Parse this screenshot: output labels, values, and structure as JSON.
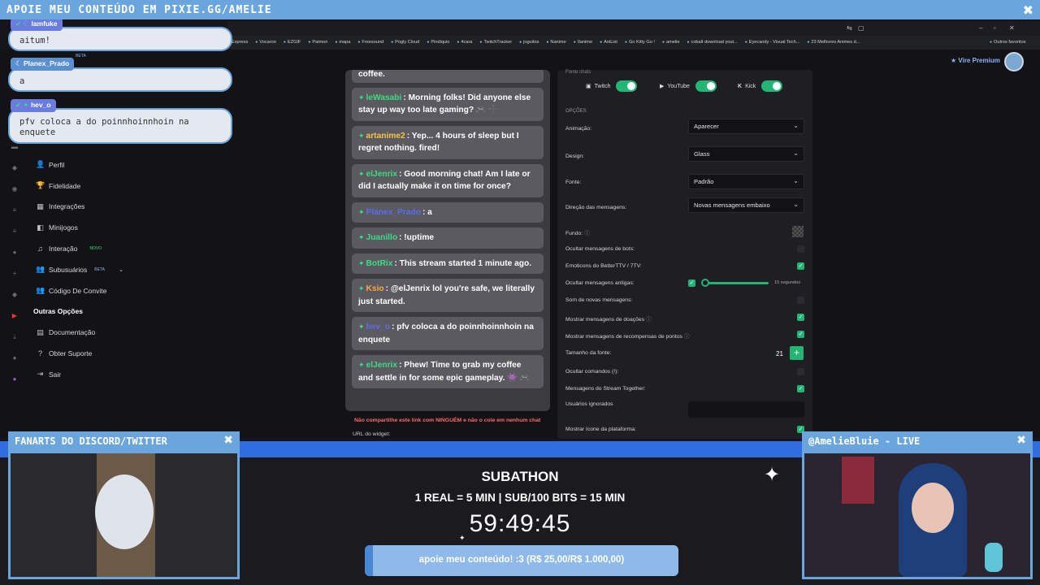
{
  "banner": {
    "text": "APOIE MEU CONTEÚDO EM PIXIE.GG/AMELIE",
    "close": "✖"
  },
  "bookmarks": [
    "Express",
    "Vocaroo",
    "EZGIF",
    "Paimon",
    "mapa",
    "Freesound",
    "Pogly Cloud",
    "Pindiquio",
    "4cara",
    "TwitchTracker",
    "joguitos",
    "Nanime",
    "9anime",
    "AniList",
    "Go Kitty Go !",
    "amelie",
    "cobalt download yout...",
    "Eyecandy - Visual Tech...",
    "23 Melhores Animes d...",
    "Outros favoritos"
  ],
  "header": {
    "premium": "Vire Premium",
    "beta": "BETA"
  },
  "nav": {
    "items": [
      {
        "label": "Perfil",
        "icon": "user-icon"
      },
      {
        "label": "Fidelidade",
        "icon": "trophy-icon"
      },
      {
        "label": "Integrações",
        "icon": "plug-icon"
      },
      {
        "label": "Minijogos",
        "icon": "gamepad-icon"
      },
      {
        "label": "Interação",
        "icon": "music-icon",
        "tag": "NOVO"
      },
      {
        "label": "Subusuários",
        "icon": "users-icon",
        "tag": "BETA"
      },
      {
        "label": "Código De Convite",
        "icon": "invite-icon"
      }
    ],
    "section_label": "Outras Opções",
    "other_items": [
      {
        "label": "Documentação",
        "icon": "book-icon"
      },
      {
        "label": "Obter Suporte",
        "icon": "help-icon"
      },
      {
        "label": "Sair",
        "icon": "logout-icon"
      }
    ]
  },
  "chat_preview": {
    "messages": [
      {
        "user": "leWasabi",
        "color": "#3ddc84",
        "text": ": Morning folks! Did anyone else stay up way too late gaming? 🎮 ➕"
      },
      {
        "user": "artanime2",
        "color": "#f5c542",
        "text": ": Yep... 4 hours of sleep but I regret nothing. fired!"
      },
      {
        "user": "elJenrix",
        "color": "#3ddc84",
        "text": ": Good morning chat! Am I late or did I actually make it on time for once?"
      },
      {
        "user": "Planex_Prado",
        "color": "#5b6cf0",
        "text": ": a"
      },
      {
        "user": "Juanillo",
        "color": "#3ddc84",
        "text": ": !uptime"
      },
      {
        "user": "BotRix",
        "color": "#3ddc84",
        "text": ": This stream started 1 minute ago."
      },
      {
        "user": "Ksio",
        "color": "#f5a742",
        "text": ": @elJenrix lol you're safe, we literally just started."
      },
      {
        "user": "hev_o",
        "color": "#5b6cf0",
        "text": ": pfv coloca a do poinnhoinnhoin na enquete"
      },
      {
        "user": "elJenrix",
        "color": "#3ddc84",
        "text": ": Phew! Time to grab my coffee and settle in for some epic gameplay. 👾 🎮"
      }
    ],
    "warning": "Não compartilhe este link com NINGUÉM e não o cole em nenhum chat",
    "widget_url_label": "URL do widget:",
    "top_fragment": "coffee."
  },
  "settings": {
    "platforms": [
      {
        "label": "Twitch"
      },
      {
        "label": "YouTube"
      },
      {
        "label": "Kick"
      }
    ],
    "section": "OPÇÕES",
    "animation_label": "Animação:",
    "animation_value": "Aparecer",
    "design_label": "Design:",
    "design_value": "Glass",
    "font_label": "Fonte:",
    "font_value": "Padrão",
    "direction_label": "Direção das mensagens:",
    "direction_value": "Novas mensagens embaixo",
    "bg_label": "Fundo:",
    "hide_bots": "Ocultar mensagens de bots:",
    "emotes": "Emoticons do BetterTTV / 7TV:",
    "hide_old": "Ocultar mensagens antigas:",
    "hide_old_value": "15 segundos",
    "sound": "Som de novas mensagens:",
    "donations": "Mostrar mensagens de doações",
    "rewards": "Mostrar mensagens de recompensas de pontos",
    "font_size_label": "Tamanho da fonte:",
    "font_size_value": "21",
    "font_size_plus": "+",
    "hide_commands": "Ocultar comandos (!):",
    "stream_together": "Mensagens do Stream Together:",
    "ignored": "Usuários ignorados",
    "platform_icon": "Mostrar ícone da plataforma:"
  },
  "overlay_chat": [
    {
      "user": "lamfuke",
      "text": "aitum!"
    },
    {
      "user": "Planex_Prado",
      "text": "a"
    },
    {
      "user": "hev_o",
      "text": "pfv coloca a do poinnhoinnhoin na enquete"
    }
  ],
  "fanart_panel": {
    "title": "FANARTS DO DISCORD/TWITTER",
    "close": "✖"
  },
  "webcam_panel": {
    "title": "@AmelieBluie - LIVE",
    "close": "✖"
  },
  "subathon": {
    "title": "SUBATHON",
    "rates": "1 REAL = 5 MIN | SUB/100 BITS = 15 MIN",
    "timer": "59:49:45",
    "goal_text": "apoie meu conteúdo! :3 (R$ 25,00/R$ 1.000,00)",
    "goal_fraction": 0.025
  }
}
